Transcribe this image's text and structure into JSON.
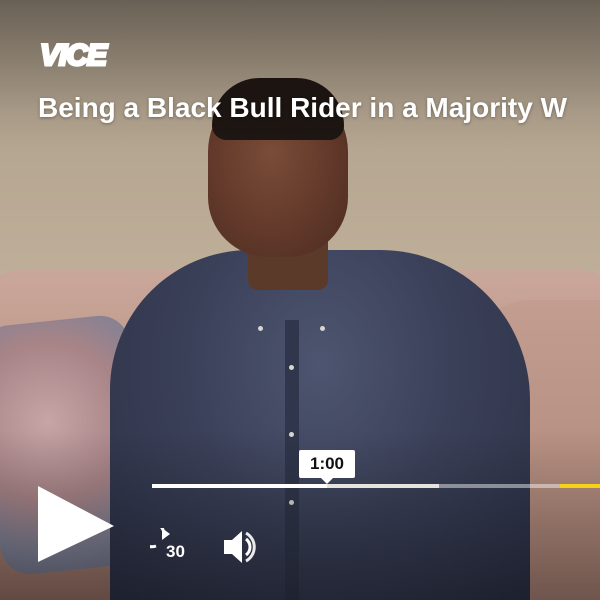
{
  "brand": {
    "logo_text": "VICE",
    "accent_color": "#f7d117"
  },
  "video": {
    "title": "Being a Black Bull Rider in a Majority W"
  },
  "controls": {
    "play_icon": "play-icon",
    "rewind_label": "30",
    "rewind_icon": "rewind-30-icon",
    "volume_icon": "volume-icon",
    "hover_time": "1:00",
    "buffered_fraction": 0.64,
    "played_fraction": 0.39,
    "marker_fraction": 0.91
  }
}
